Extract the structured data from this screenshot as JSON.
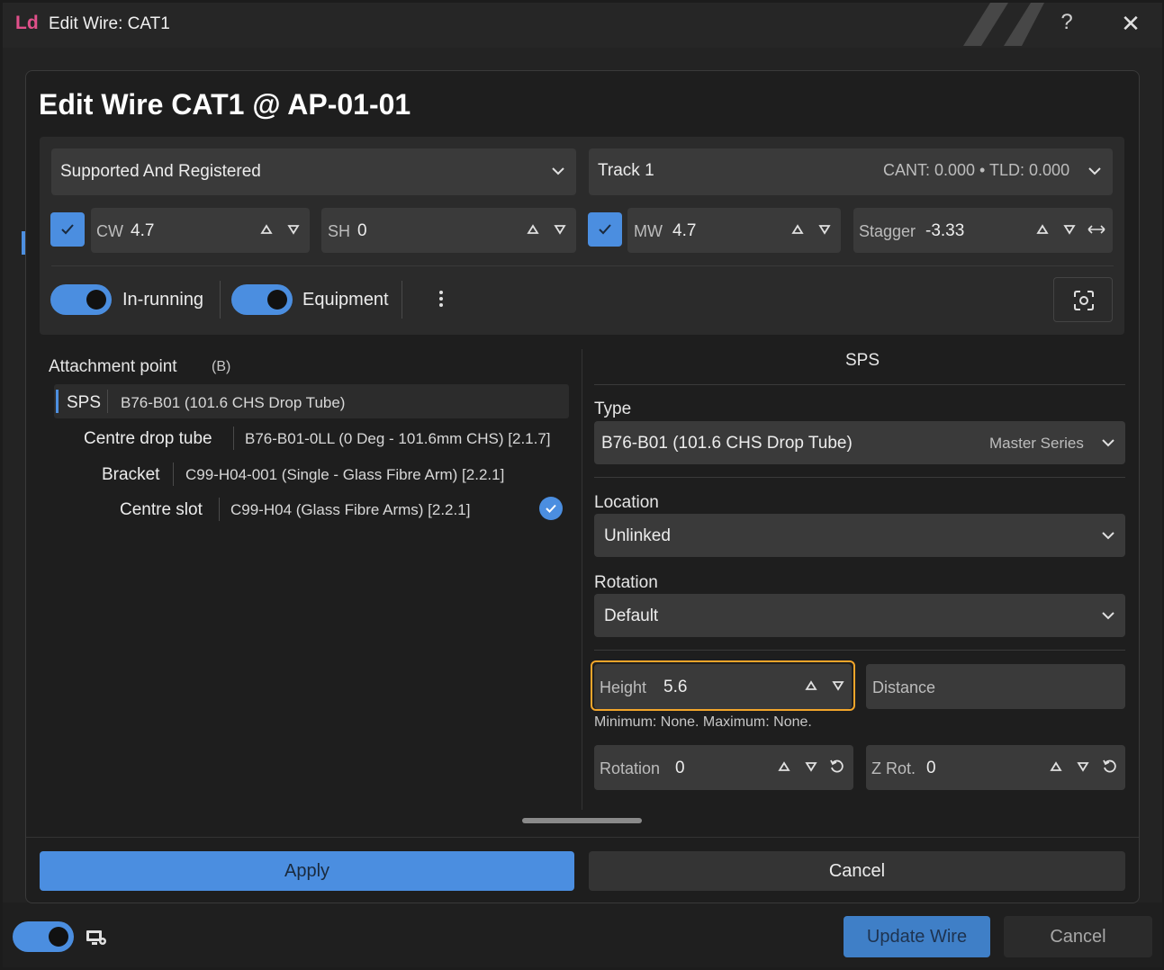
{
  "window": {
    "logo": "Ld",
    "title": "Edit Wire: CAT1",
    "help": "?",
    "close": "✕"
  },
  "dialog": {
    "title": "Edit Wire CAT1 @ AP-01-01",
    "wire_mode": "Supported And Registered",
    "track": "Track 1",
    "track_info": "CANT: 0.000 • TLD: 0.000",
    "cw": {
      "label": "CW",
      "value": "4.7",
      "checked": true
    },
    "sh": {
      "label": "SH",
      "value": "0"
    },
    "mw": {
      "label": "MW",
      "value": "4.7",
      "checked": true
    },
    "stagger": {
      "label": "Stagger",
      "value": "-3.33"
    },
    "in_running": {
      "label": "In-running",
      "on": true
    },
    "equipment": {
      "label": "Equipment",
      "on": true
    }
  },
  "attachment": {
    "header": "Attachment point",
    "header_sub": "(B)",
    "rows": [
      {
        "name": "SPS",
        "value": "B76-B01 (101.6 CHS Drop Tube)"
      },
      {
        "name": "Centre drop tube",
        "value": "B76-B01-0LL (0 Deg - 101.6mm CHS) [2.1.7]"
      },
      {
        "name": "Bracket",
        "value": "C99-H04-001 (Single - Glass Fibre Arm) [2.2.1]"
      },
      {
        "name": "Centre slot",
        "value": "C99-H04 (Glass Fibre Arms) [2.2.1]"
      }
    ]
  },
  "sps": {
    "header": "SPS",
    "type_label": "Type",
    "type_value": "B76-B01 (101.6 CHS Drop Tube)",
    "type_series": "Master Series",
    "location_label": "Location",
    "location_value": "Unlinked",
    "rotation_label": "Rotation",
    "rotation_value": "Default",
    "height": {
      "label": "Height",
      "value": "5.6"
    },
    "distance": {
      "label": "Distance"
    },
    "limits": "Minimum: None. Maximum: None.",
    "rotation_field": {
      "label": "Rotation",
      "value": "0"
    },
    "zrot_field": {
      "label": "Z Rot.",
      "value": "0"
    }
  },
  "buttons": {
    "apply": "Apply",
    "cancel": "Cancel",
    "update_wire": "Update Wire",
    "footer_cancel": "Cancel"
  },
  "colors": {
    "accent": "#4b8ee0",
    "highlight": "#f2a52a",
    "logo": "#e0508a"
  }
}
